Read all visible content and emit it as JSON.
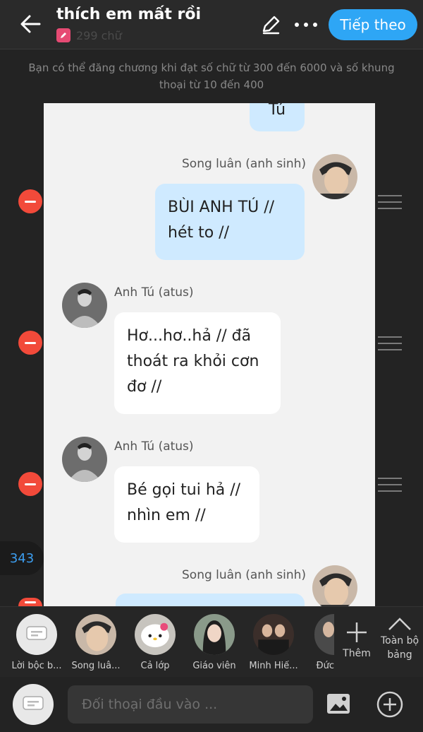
{
  "header": {
    "title": "thích em mất rồi",
    "word_count": "299 chữ",
    "next_label": "Tiếp theo"
  },
  "notice": "Bạn có thể đăng chương khi đạt số chữ từ 300 đến 6000 và số khung thoại từ 10 đến 400",
  "messages": [
    {
      "speaker": "",
      "text": "Tú",
      "side": "right"
    },
    {
      "speaker": "Song luân (anh sinh)",
      "text": "BÙI ANH TÚ // hét to //",
      "side": "right"
    },
    {
      "speaker": "Anh Tú (atus)",
      "text": "Hơ...hơ..hả // đã thoát ra khỏi cơn đơ //",
      "side": "left"
    },
    {
      "speaker": "Anh Tú (atus)",
      "text": "Bé gọi tui hả // nhìn em //",
      "side": "left"
    },
    {
      "speaker": "Song luân (anh sinh)",
      "text": "",
      "side": "right"
    }
  ],
  "dialogue_count": "343",
  "characters": [
    {
      "label": "Lời bộc b...",
      "icon": "narration-icon"
    },
    {
      "label": "Song luâ...",
      "icon": "avatar-song-luan"
    },
    {
      "label": "Cả lớp",
      "icon": "avatar-ca-lop"
    },
    {
      "label": "Giáo viên",
      "icon": "avatar-giao-vien"
    },
    {
      "label": "Minh Hiế...",
      "icon": "avatar-minh-hieu"
    },
    {
      "label": "Đức",
      "icon": "avatar-duc"
    }
  ],
  "add_label": "Thêm",
  "full_board_label": "Toàn bộ bảng",
  "input": {
    "placeholder": "Đối thoại đầu vào ..."
  },
  "colors": {
    "accent": "#2ea6f5",
    "remove": "#f24a3a",
    "bubble_self": "#cfeaff",
    "bubble_other": "#ffffff"
  }
}
